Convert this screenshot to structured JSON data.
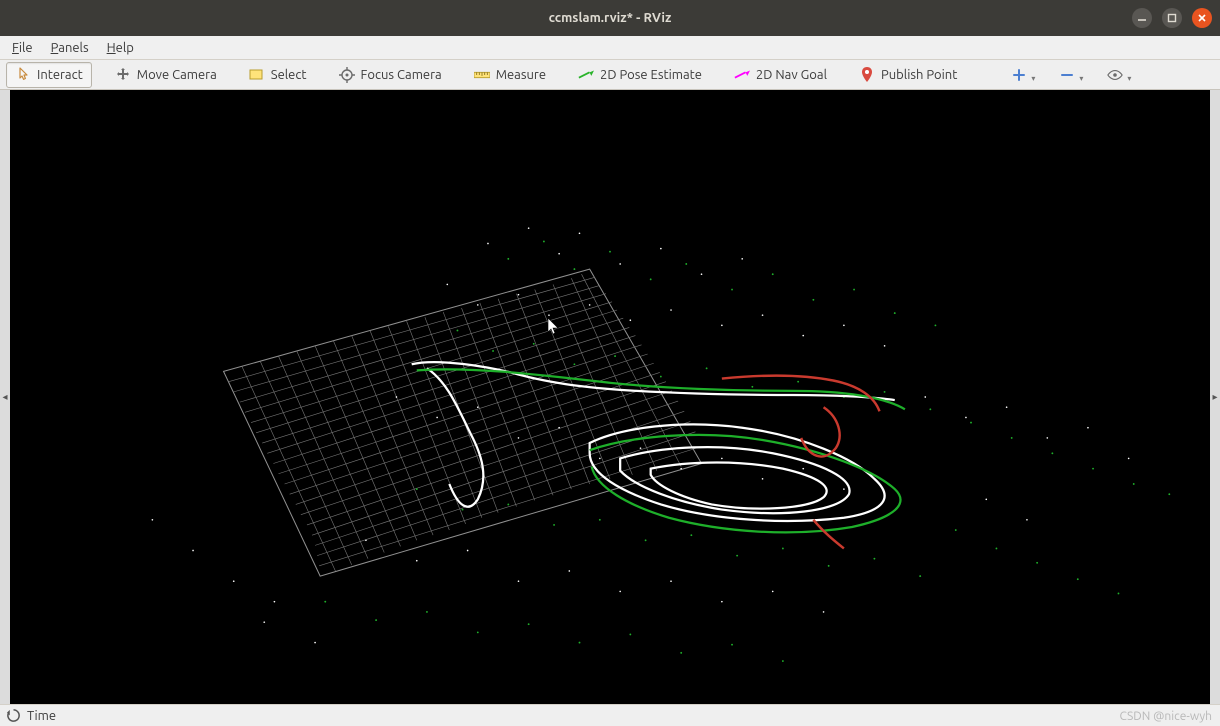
{
  "window": {
    "title": "ccmslam.rviz* - RViz"
  },
  "menubar": {
    "file": "File",
    "panels": "Panels",
    "help": "Help"
  },
  "toolbar": {
    "interact": "Interact",
    "move_camera": "Move Camera",
    "select": "Select",
    "focus_camera": "Focus Camera",
    "measure": "Measure",
    "pose_estimate": "2D Pose Estimate",
    "nav_goal": "2D Nav Goal",
    "publish_point": "Publish Point"
  },
  "statusbar": {
    "label": "Time"
  },
  "watermark": "CSDN @nice-wyh",
  "icons": {
    "interact": "interact-icon",
    "move_camera": "move-camera-icon",
    "select": "select-icon",
    "focus_camera": "focus-camera-icon",
    "measure": "measure-icon",
    "pose_estimate": "pose-estimate-icon",
    "nav_goal": "nav-goal-icon",
    "publish_point": "publish-point-icon",
    "plus": "plus-icon",
    "minus": "minus-icon",
    "eye": "eye-icon",
    "minimize": "minimize-window-icon",
    "maximize": "maximize-window-icon",
    "close": "close-window-icon",
    "reset": "reset-time-icon"
  },
  "colors": {
    "titlebar": "#3c3b37",
    "accent_close": "#e95420",
    "pose_green": "#29b32a",
    "nav_magenta": "#ff00ff",
    "publish_red": "#b72a2a",
    "plus_blue": "#4c7fd1"
  }
}
